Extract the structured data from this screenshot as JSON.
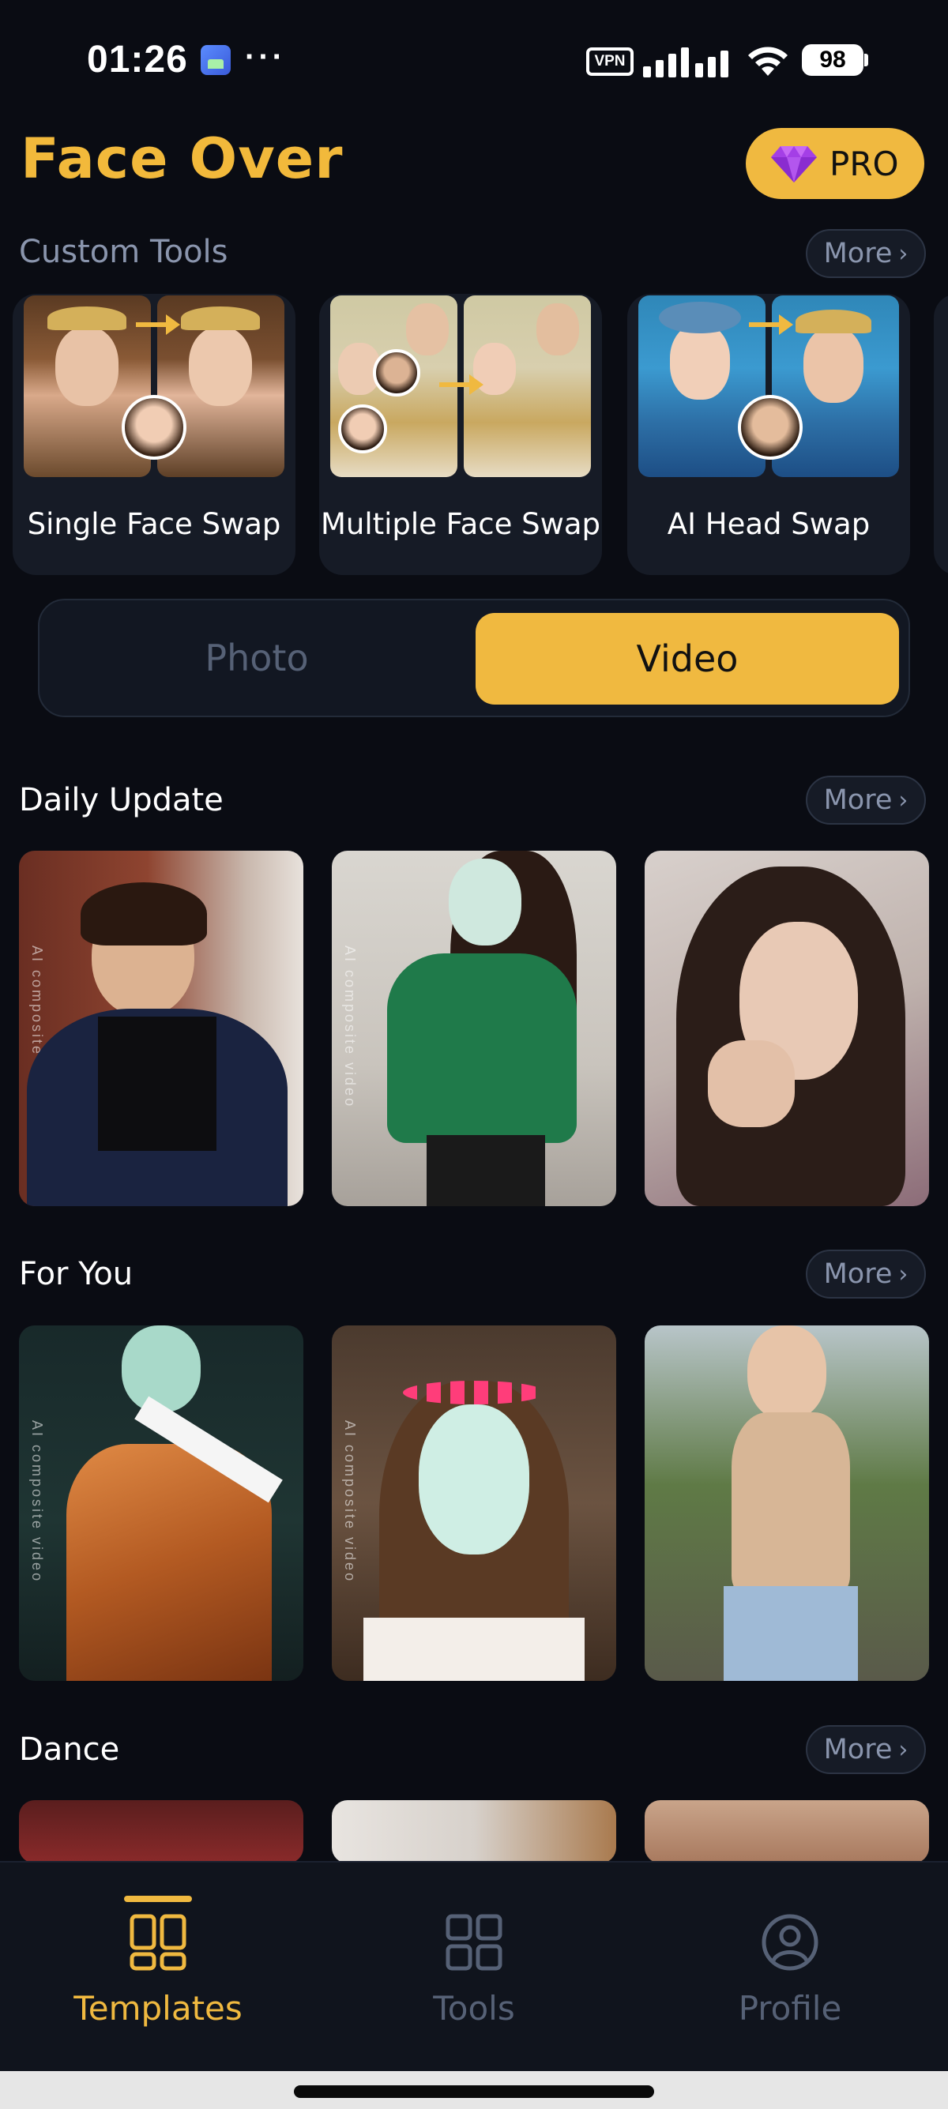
{
  "status_bar": {
    "time": "01:26",
    "dots": "···",
    "vpn": "VPN",
    "battery": "98"
  },
  "header": {
    "title": "Face Over",
    "pro_label": "PRO",
    "accent": "#f0b940"
  },
  "custom_tools": {
    "title": "Custom Tools",
    "more": "More",
    "items": [
      {
        "label": "Single Face Swap"
      },
      {
        "label": "Multiple Face Swap"
      },
      {
        "label": "AI Head Swap"
      }
    ]
  },
  "media_toggle": {
    "photo": "Photo",
    "video": "Video",
    "selected": "Video"
  },
  "sections": [
    {
      "title": "Daily Update",
      "more": "More",
      "watermark": "AI composite video"
    },
    {
      "title": "For You",
      "more": "More",
      "watermark": "AI composite video"
    },
    {
      "title": "Dance",
      "more": "More"
    }
  ],
  "bottom_nav": {
    "items": [
      {
        "label": "Templates",
        "icon": "grid-icon",
        "active": true
      },
      {
        "label": "Tools",
        "icon": "tools-grid-icon",
        "active": false
      },
      {
        "label": "Profile",
        "icon": "person-icon",
        "active": false
      }
    ]
  }
}
